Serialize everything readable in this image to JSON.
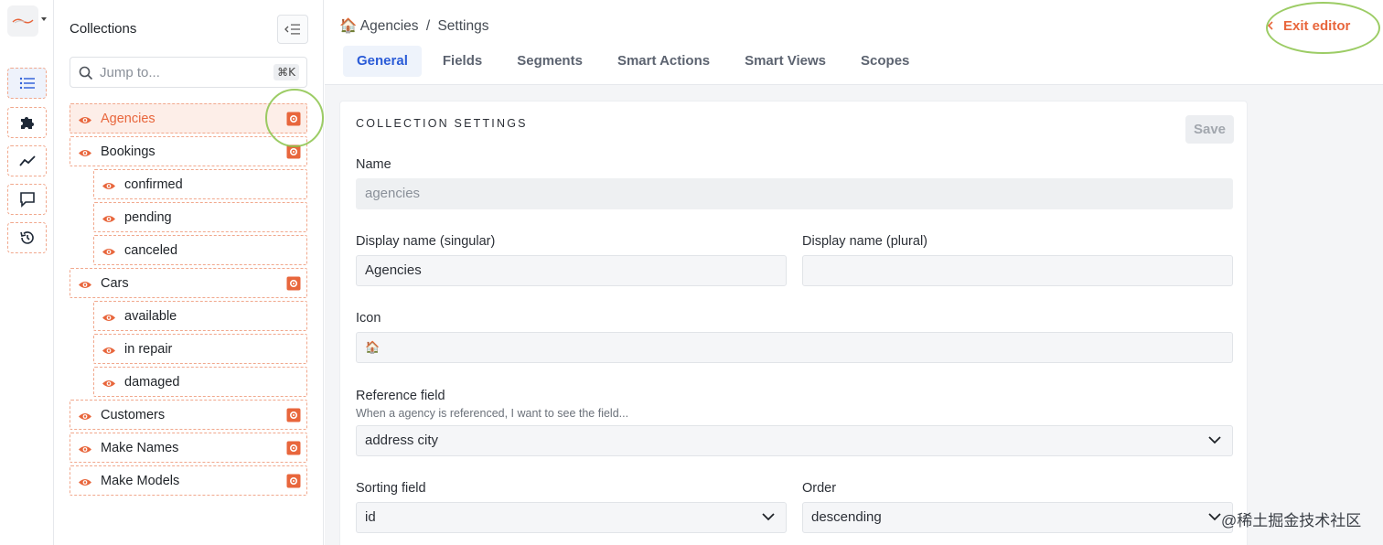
{
  "sidebar": {
    "rail": [
      "list-icon",
      "puzzle-icon",
      "chart-line-icon",
      "chat-icon",
      "history-icon"
    ]
  },
  "collections": {
    "title": "Collections",
    "search_placeholder": "Jump to...",
    "shortcut": "⌘K",
    "items": [
      {
        "label": "Agencies",
        "level": 0,
        "selected": true
      },
      {
        "label": "Bookings",
        "level": 0
      },
      {
        "label": "confirmed",
        "level": 1
      },
      {
        "label": "pending",
        "level": 1
      },
      {
        "label": "canceled",
        "level": 1
      },
      {
        "label": "Cars",
        "level": 0
      },
      {
        "label": "available",
        "level": 1
      },
      {
        "label": "in repair",
        "level": 1
      },
      {
        "label": "damaged",
        "level": 1
      },
      {
        "label": "Customers",
        "level": 0
      },
      {
        "label": "Make Names",
        "level": 0
      },
      {
        "label": "Make Models",
        "level": 0
      }
    ]
  },
  "header": {
    "breadcrumb_icon": "🏠",
    "breadcrumb_collection": "Agencies",
    "breadcrumb_sep": "/",
    "breadcrumb_page": "Settings",
    "exit_label": "Exit editor",
    "tabs": [
      "General",
      "Fields",
      "Segments",
      "Smart Actions",
      "Smart Views",
      "Scopes"
    ],
    "active_tab": "General"
  },
  "settings": {
    "section_title": "COLLECTION SETTINGS",
    "save_label": "Save",
    "name_label": "Name",
    "name_value": "agencies",
    "display_singular_label": "Display name (singular)",
    "display_singular_value": "Agencies",
    "display_plural_label": "Display name (plural)",
    "display_plural_value": "",
    "icon_label": "Icon",
    "icon_value": "🏠",
    "reference_label": "Reference field",
    "reference_hint": "When a agency is referenced, I want to see the field...",
    "reference_value": "address city",
    "sorting_label": "Sorting field",
    "sorting_value": "id",
    "order_label": "Order",
    "order_value": "descending"
  },
  "watermark": "@稀土掘金技术社区",
  "colors": {
    "accent": "#e8663c",
    "active_tab": "#2a5bd7",
    "ring": "#8bc34a"
  }
}
